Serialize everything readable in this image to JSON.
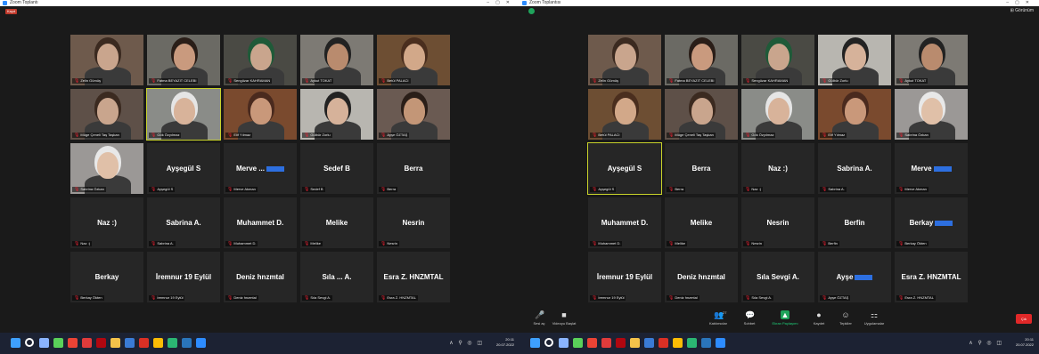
{
  "left": {
    "window_title": "Zoom Toplantı",
    "record_label": "Kayıt",
    "tiles": [
      {
        "name": "Zelin Gümüş",
        "video": true,
        "skin": "#c9a58d",
        "hair": "#3b2a20",
        "bg": "#6e5a4c"
      },
      {
        "name": "Fatma BEYAZIT CELEBI",
        "video": true,
        "skin": "#c99a7e",
        "hair": "#2a1e18",
        "bg": "#6b6a64"
      },
      {
        "name": "Sengüzar KAHRAMAN",
        "video": true,
        "skin": "#c9a58d",
        "hair": "#1f5a38",
        "bg": "#4a4a44"
      },
      {
        "name": "Aykut TOKAT",
        "video": true,
        "skin": "#b98b6e",
        "hair": "#222",
        "bg": "#7d7a74"
      },
      {
        "name": "Betül PALACI",
        "video": true,
        "skin": "#d2a889",
        "hair": "#4a2e1e",
        "bg": "#6d4e33"
      },
      {
        "name": "Müge Çeneli Taş Taşkan",
        "video": true,
        "skin": "#c9a58d",
        "hair": "#3b2a20",
        "bg": "#5e5048"
      },
      {
        "name": "Gök Özyılmaz",
        "video": true,
        "skin": "#d8b39a",
        "hair": "#e5e5e5",
        "bg": "#8a8c88",
        "selected": true
      },
      {
        "name": "Elif Yılmaz",
        "video": true,
        "skin": "#c9987a",
        "hair": "#4a2a1e",
        "bg": "#7a4a2e"
      },
      {
        "name": "Gülbür Zorlu",
        "video": true,
        "skin": "#d6b29a",
        "hair": "#222",
        "bg": "#b8b6b0"
      },
      {
        "name": "Ayşe ÖZTAŞ",
        "video": true,
        "skin": "#c39677",
        "hair": "#2a1e18",
        "bg": "#6a5a52"
      },
      {
        "name": "Sabrina Özkan",
        "video": true,
        "skin": "#e0c0a8",
        "hair": "#e8e8e8",
        "bg": "#9b9896"
      },
      {
        "name": "Ayşegül S",
        "video": false,
        "label": "Ayşegül S"
      },
      {
        "name": "Merve ...",
        "video": false,
        "label": "Merve Akman",
        "blue": true
      },
      {
        "name": "Sedef B",
        "video": false,
        "label": "Sedef B"
      },
      {
        "name": "Berra",
        "video": false,
        "label": "Berra"
      },
      {
        "name": "Naz :)",
        "video": false,
        "label": "Naz :)"
      },
      {
        "name": "Sabrina A.",
        "video": false,
        "label": "Sabrina A."
      },
      {
        "name": "Muhammet D.",
        "video": false,
        "label": "Muhammet D."
      },
      {
        "name": "Melike",
        "video": false,
        "label": "Melike"
      },
      {
        "name": "Nesrin",
        "video": false,
        "label": "Nesrin"
      },
      {
        "name": "Berkay",
        "video": false,
        "label": "Berkay Ökten"
      },
      {
        "name": "İremnur 19 Eylül",
        "video": false,
        "label": "İremnur 19 Eylül"
      },
      {
        "name": "Deniz hnzmtal",
        "video": false,
        "label": "Deniz hnzmtal"
      },
      {
        "name": "Sıla ... A.",
        "video": false,
        "label": "Sıla Sevgi A."
      },
      {
        "name": "Esra Z. HNZMTAL",
        "video": false,
        "label": "Esra Z. HNZMTAL"
      }
    ],
    "clock": {
      "time": "20:11",
      "date": "20.07.2022"
    }
  },
  "right": {
    "window_title": "Zoom Toplantısı",
    "view_label": "Görünüm",
    "tiles": [
      {
        "name": "Zelin Gümüş",
        "video": true,
        "skin": "#c9a58d",
        "hair": "#3b2a20",
        "bg": "#6e5a4c"
      },
      {
        "name": "Fatma BEYAZIT CELEBI",
        "video": true,
        "skin": "#c99a7e",
        "hair": "#2a1e18",
        "bg": "#6b6a64"
      },
      {
        "name": "Sengüzar KAHRAMAN",
        "video": true,
        "skin": "#c9a58d",
        "hair": "#1f5a38",
        "bg": "#4a4a44"
      },
      {
        "name": "Gülbür Zorlu",
        "video": true,
        "skin": "#d6b29a",
        "hair": "#222",
        "bg": "#b8b6b0"
      },
      {
        "name": "Aykut TOKAT",
        "video": true,
        "skin": "#b98b6e",
        "hair": "#222",
        "bg": "#7d7a74"
      },
      {
        "name": "Betül PALACI",
        "video": true,
        "skin": "#d2a889",
        "hair": "#4a2e1e",
        "bg": "#6d4e33"
      },
      {
        "name": "Müge Çeneli Taş Taşkan",
        "video": true,
        "skin": "#c9a58d",
        "hair": "#3b2a20",
        "bg": "#5e5048"
      },
      {
        "name": "Gök Özyılmaz",
        "video": true,
        "skin": "#d8b39a",
        "hair": "#e5e5e5",
        "bg": "#8a8c88"
      },
      {
        "name": "Elif Yılmaz",
        "video": true,
        "skin": "#c9987a",
        "hair": "#4a2a1e",
        "bg": "#7a4a2e"
      },
      {
        "name": "Sabrina Özkan",
        "video": true,
        "skin": "#e0c0a8",
        "hair": "#e8e8e8",
        "bg": "#9b9896"
      },
      {
        "name": "Ayşegül S",
        "video": false,
        "label": "Ayşegül S",
        "selected": true
      },
      {
        "name": "Berra",
        "video": false,
        "label": "Berra"
      },
      {
        "name": "Naz :)",
        "video": false,
        "label": "Naz :)"
      },
      {
        "name": "Sabrina A.",
        "video": false,
        "label": "Sabrina A."
      },
      {
        "name": "Merve",
        "video": false,
        "label": "Merve Akman",
        "blue": true
      },
      {
        "name": "Muhammet D.",
        "video": false,
        "label": "Muhammet D."
      },
      {
        "name": "Melike",
        "video": false,
        "label": "Melike"
      },
      {
        "name": "Nesrin",
        "video": false,
        "label": "Nesrin"
      },
      {
        "name": "Berfin",
        "video": false,
        "label": "Berfin"
      },
      {
        "name": "Berkay",
        "video": false,
        "label": "Berkay Ökten",
        "blue": true
      },
      {
        "name": "İremnur 19 Eylül",
        "video": false,
        "label": "İremnur 19 Eylül"
      },
      {
        "name": "Deniz hnzmtal",
        "video": false,
        "label": "Deniz hnzmtal"
      },
      {
        "name": "Sıla Sevgi A.",
        "video": false,
        "label": "Sıla Sevgi A."
      },
      {
        "name": "Ayşe",
        "video": false,
        "label": "Ayşe ÖZTAŞ",
        "blue": true
      },
      {
        "name": "Esra Z. HNZMTAL",
        "video": false,
        "label": "Esra Z. HNZMTAL"
      }
    ],
    "controls": [
      {
        "id": "mic",
        "label": "Sesi aç",
        "icon": "🎤"
      },
      {
        "id": "video",
        "label": "Videoyu Başlat",
        "icon": "■"
      },
      {
        "id": "participants",
        "label": "Katılımcılar",
        "icon": "👥"
      },
      {
        "id": "chat",
        "label": "Sohbet",
        "icon": "💬"
      },
      {
        "id": "share",
        "label": "Ekran Paylaşımı",
        "icon": "▲"
      },
      {
        "id": "record",
        "label": "Kaydet",
        "icon": "●"
      },
      {
        "id": "reactions",
        "label": "Tepkiler",
        "icon": "☺"
      },
      {
        "id": "apps",
        "label": "Uygulamalar",
        "icon": "⚏"
      }
    ],
    "participants_count": "27",
    "end_label": "Çık",
    "clock": {
      "time": "20:11",
      "date": "20.07.2022"
    }
  }
}
